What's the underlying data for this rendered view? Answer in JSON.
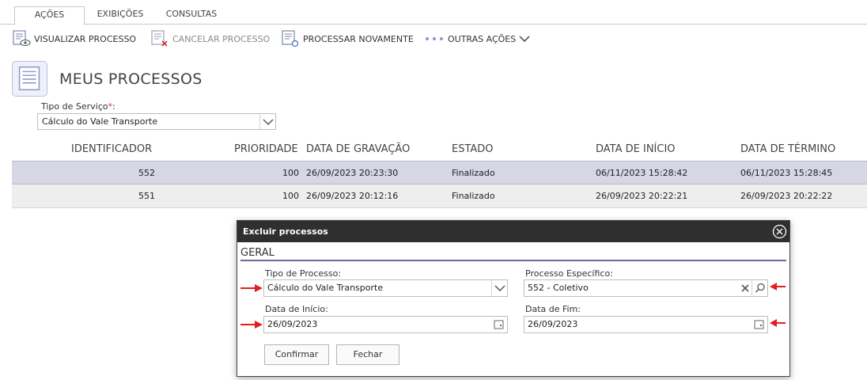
{
  "tabs": [
    {
      "label": "AÇÕES",
      "active": true
    },
    {
      "label": "EXIBIÇÕES",
      "active": false
    },
    {
      "label": "CONSULTAS",
      "active": false
    }
  ],
  "toolbar": {
    "view_label": "VISUALIZAR PROCESSO",
    "cancel_label": "CANCELAR PROCESSO",
    "reprocess_label": "PROCESSAR NOVAMENTE",
    "more_label": "OUTRAS AÇÕES"
  },
  "page": {
    "title": "MEUS PROCESSOS",
    "service_label": "Tipo de Serviço",
    "service_required": "*",
    "service_colon": ":",
    "service_value": "Cálculo do Vale Transporte"
  },
  "table": {
    "headers": [
      "IDENTIFICADOR",
      "PRIORIDADE",
      "DATA DE GRAVAÇÃO",
      "ESTADO",
      "DATA DE INÍCIO",
      "DATA DE TÉRMINO"
    ],
    "rows": [
      {
        "id": "552",
        "priority": "100",
        "recorded": "26/09/2023 20:23:30",
        "state": "Finalizado",
        "start": "06/11/2023 15:28:42",
        "end": "06/11/2023 15:28:45",
        "selected": true
      },
      {
        "id": "551",
        "priority": "100",
        "recorded": "26/09/2023 20:12:16",
        "state": "Finalizado",
        "start": "26/09/2023 20:22:21",
        "end": "26/09/2023 20:22:22",
        "selected": false
      }
    ]
  },
  "modal": {
    "title": "Excluir processos",
    "section": "GERAL",
    "process_type_label": "Tipo de Processo:",
    "process_type_value": "Cálculo do Vale Transporte",
    "specific_label": "Processo Específico:",
    "specific_value": "552 - Coletivo",
    "start_label": "Data de Início:",
    "start_value": "26/09/2023",
    "end_label": "Data de Fim:",
    "end_value": "26/09/2023",
    "confirm_label": "Confirmar",
    "close_label": "Fechar"
  },
  "colors": {
    "selected_row": "#d6d6e4",
    "modal_header": "#2f2f2f",
    "annotation_arrow": "#e02020",
    "section_rule": "#6a6a9a"
  }
}
